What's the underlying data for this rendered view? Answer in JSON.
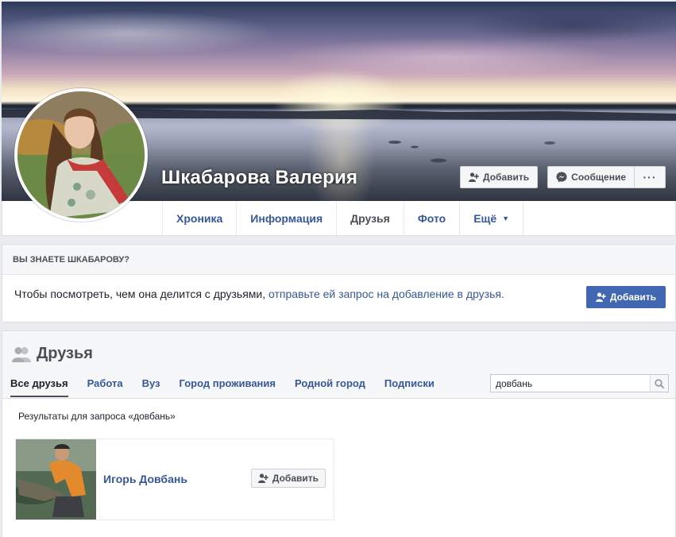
{
  "profile": {
    "name": "Шкабарова Валерия"
  },
  "cover_actions": {
    "add_friend_label": "Добавить",
    "message_label": "Сообщение",
    "more_label": "···"
  },
  "tabs": [
    {
      "label": "Хроника",
      "active": false
    },
    {
      "label": "Информация",
      "active": false
    },
    {
      "label": "Друзья",
      "active": true
    },
    {
      "label": "Фото",
      "active": false
    },
    {
      "label": "Ещё",
      "active": false,
      "dropdown": true
    }
  ],
  "know_box": {
    "header": "ВЫ ЗНАЕТЕ ШКАБАРОВУ?",
    "text": "Чтобы посмотреть, чем она делится с друзьями,",
    "link_text": "отправьте ей запрос на добавление в друзья.",
    "button_label": "Добавить"
  },
  "friends": {
    "title": "Друзья",
    "sub_tabs": [
      {
        "label": "Все друзья",
        "active": true
      },
      {
        "label": "Работа",
        "active": false
      },
      {
        "label": "Вуз",
        "active": false
      },
      {
        "label": "Город проживания",
        "active": false
      },
      {
        "label": "Родной город",
        "active": false
      },
      {
        "label": "Подписки",
        "active": false
      }
    ],
    "search_value": "довбань",
    "results_label": "Результаты для запроса «довбань»",
    "results": [
      {
        "name": "Игорь Довбань",
        "button_label": "Добавить"
      }
    ]
  },
  "colors": {
    "link": "#365899",
    "primary": "#4267b2",
    "background": "#e9ebee"
  }
}
